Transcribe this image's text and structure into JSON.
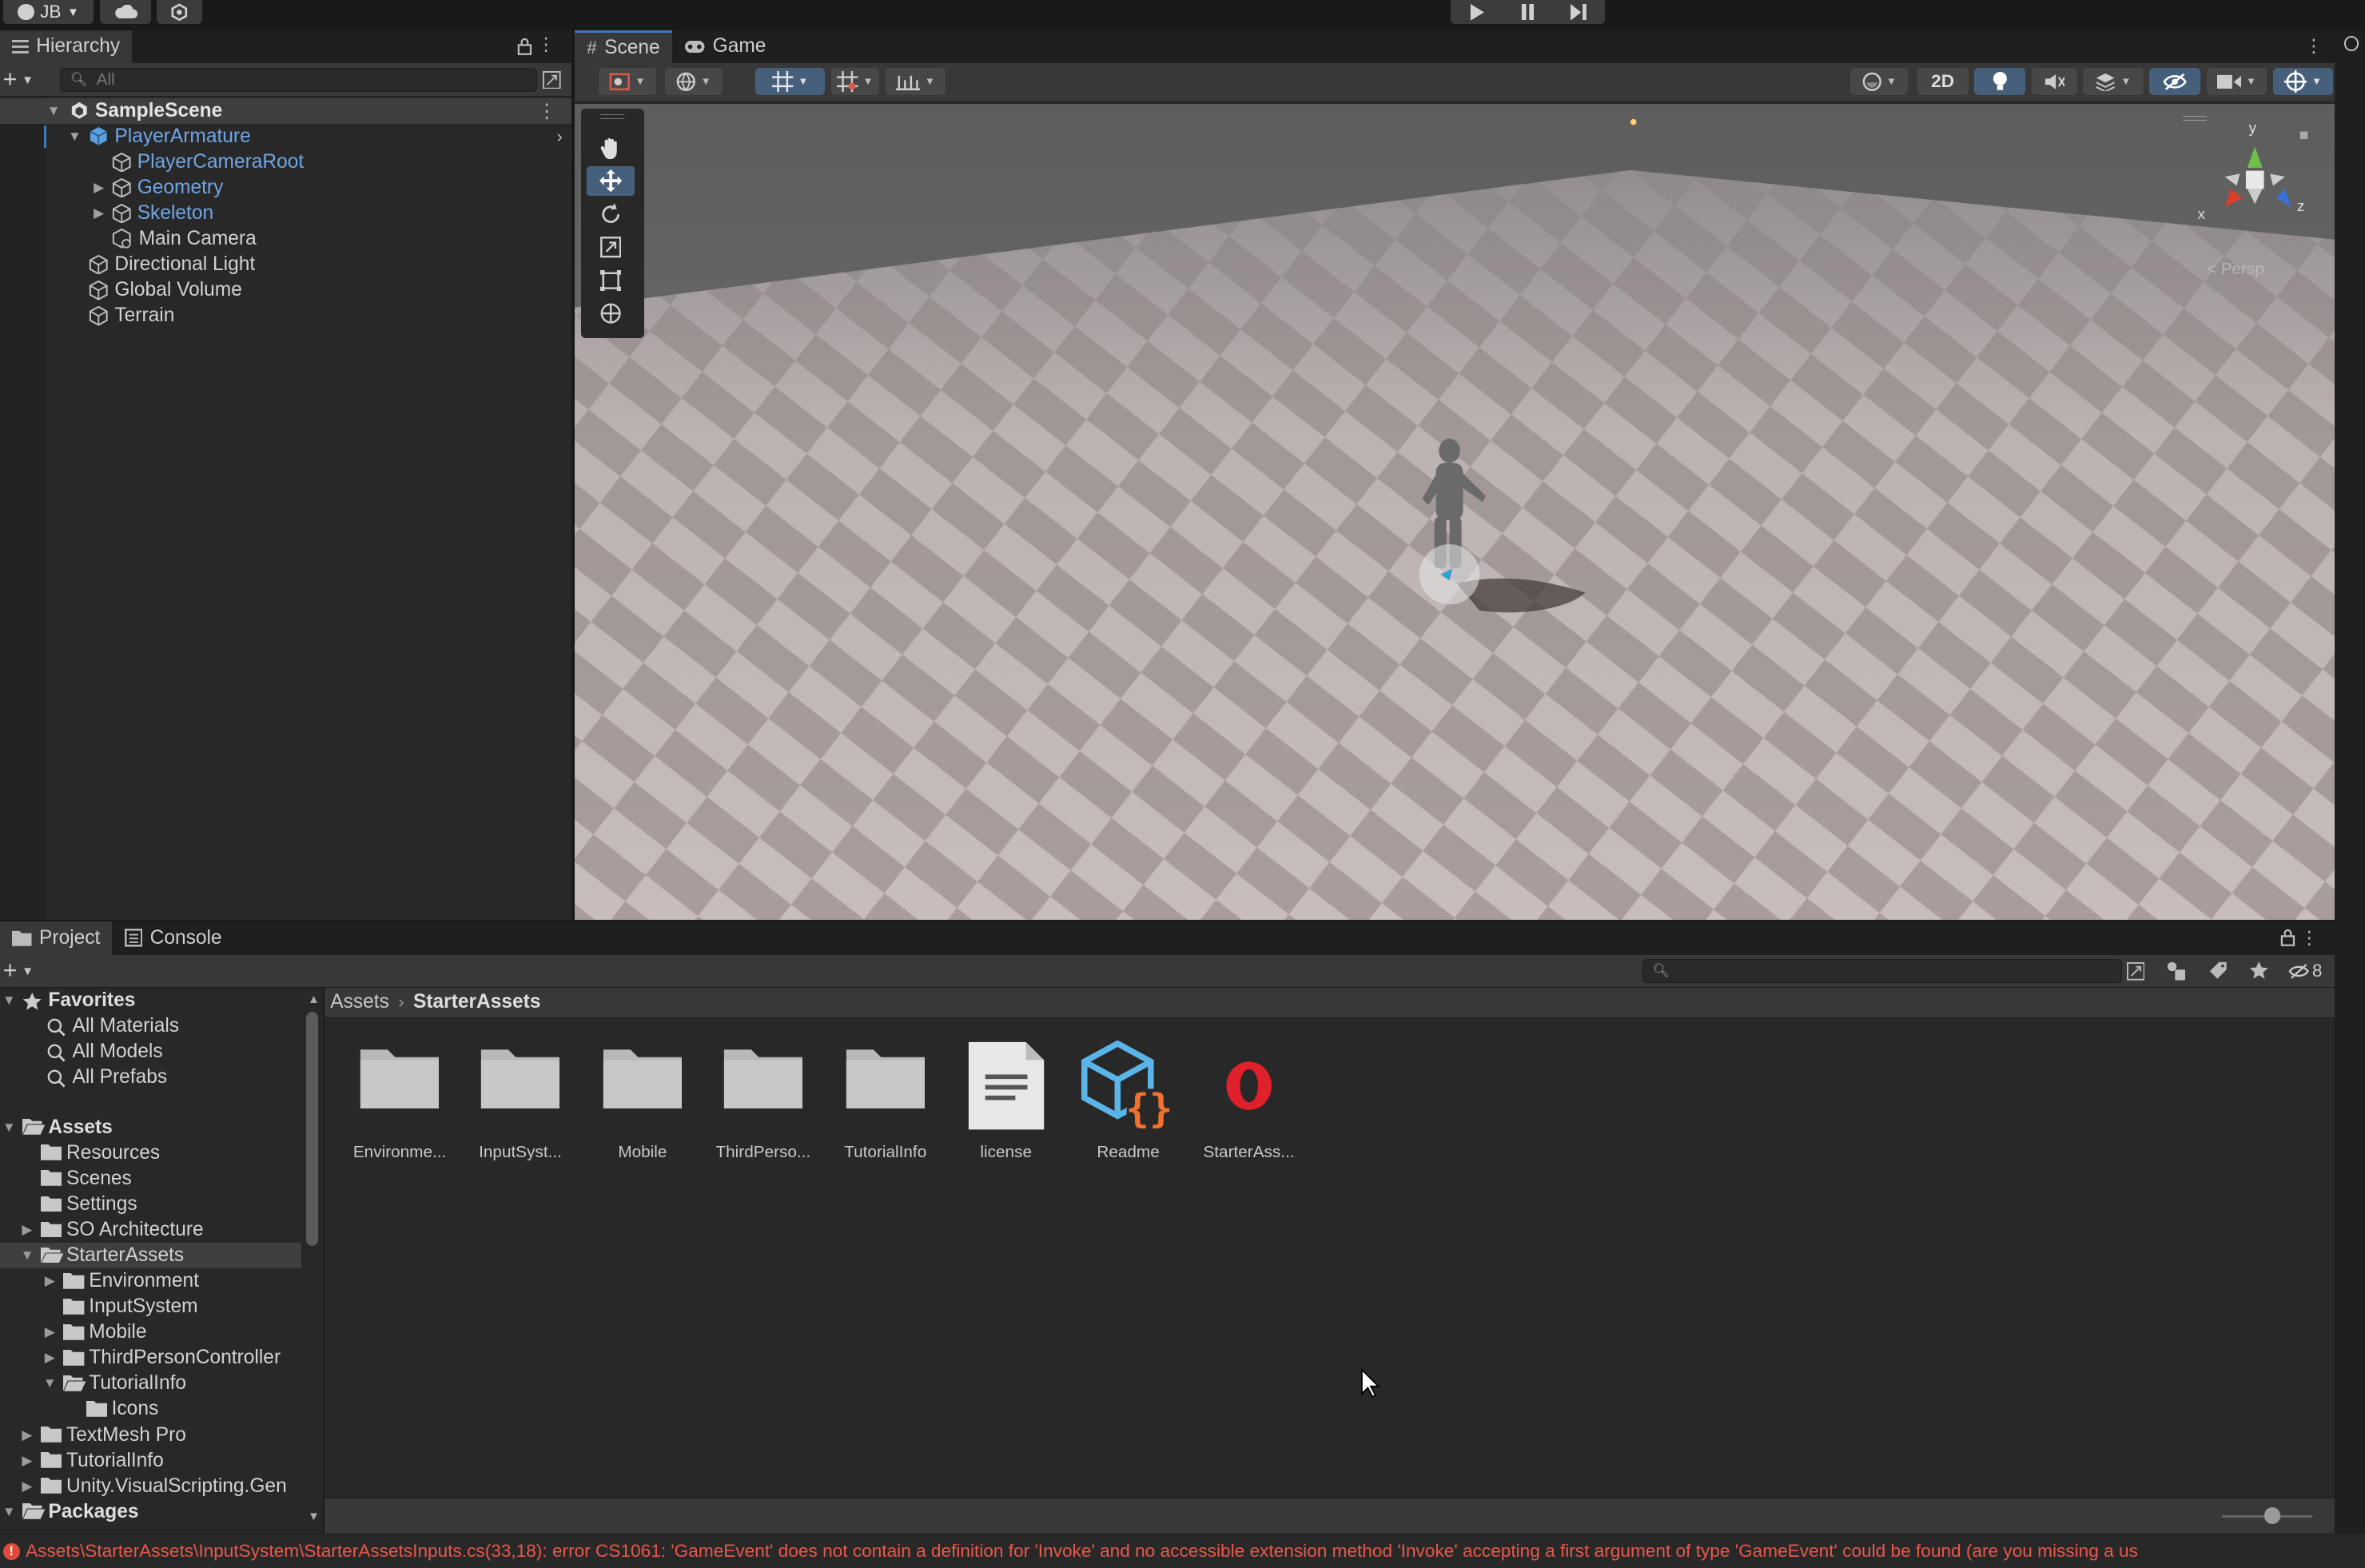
{
  "topbar": {
    "account_label": "JB"
  },
  "hierarchy": {
    "tab_label": "Hierarchy",
    "search_placeholder": "All",
    "items": [
      {
        "label": "SampleScene",
        "type": "scene"
      },
      {
        "label": "PlayerArmature",
        "type": "prefab"
      },
      {
        "label": "PlayerCameraRoot",
        "type": "prefab-child"
      },
      {
        "label": "Geometry",
        "type": "prefab-child"
      },
      {
        "label": "Skeleton",
        "type": "prefab-child"
      },
      {
        "label": "Main Camera",
        "type": "object"
      },
      {
        "label": "Directional Light",
        "type": "object"
      },
      {
        "label": "Global Volume",
        "type": "object"
      },
      {
        "label": "Terrain",
        "type": "object"
      }
    ]
  },
  "scene_view": {
    "tabs": [
      {
        "label": "Scene",
        "icon": "grid-icon",
        "active": true
      },
      {
        "label": "Game",
        "icon": "gamepad-icon",
        "active": false
      }
    ],
    "mode_2d_label": "2D",
    "projection_label": "< Persp",
    "axis_labels": {
      "x": "x",
      "y": "y",
      "z": "z"
    },
    "tools": [
      "hand-tool",
      "move-tool",
      "rotate-tool",
      "scale-tool",
      "rect-tool",
      "transform-tool"
    ],
    "active_tool": "move-tool"
  },
  "project": {
    "tabs": [
      {
        "label": "Project",
        "icon": "folder-icon",
        "active": true
      },
      {
        "label": "Console",
        "icon": "console-icon",
        "active": false
      }
    ],
    "hidden_count": "8",
    "breadcrumb": [
      "Assets",
      "StarterAssets"
    ],
    "tree": [
      {
        "label": "Favorites",
        "level": 0,
        "kind": "star",
        "bold": true,
        "arrow": "down"
      },
      {
        "label": "All Materials",
        "level": 1,
        "kind": "search"
      },
      {
        "label": "All Models",
        "level": 1,
        "kind": "search"
      },
      {
        "label": "All Prefabs",
        "level": 1,
        "kind": "search"
      },
      {
        "label": "Assets",
        "level": 0,
        "kind": "folder-open",
        "bold": true,
        "arrow": "down"
      },
      {
        "label": "Resources",
        "level": 1,
        "kind": "folder"
      },
      {
        "label": "Scenes",
        "level": 1,
        "kind": "folder"
      },
      {
        "label": "Settings",
        "level": 1,
        "kind": "folder"
      },
      {
        "label": "SO Architecture",
        "level": 1,
        "kind": "folder",
        "arrow": "right"
      },
      {
        "label": "StarterAssets",
        "level": 1,
        "kind": "folder-open",
        "arrow": "down",
        "selected": true
      },
      {
        "label": "Environment",
        "level": 2,
        "kind": "folder",
        "arrow": "right"
      },
      {
        "label": "InputSystem",
        "level": 2,
        "kind": "folder"
      },
      {
        "label": "Mobile",
        "level": 2,
        "kind": "folder",
        "arrow": "right"
      },
      {
        "label": "ThirdPersonController",
        "level": 2,
        "kind": "folder",
        "arrow": "right"
      },
      {
        "label": "TutorialInfo",
        "level": 2,
        "kind": "folder-open",
        "arrow": "down"
      },
      {
        "label": "Icons",
        "level": 3,
        "kind": "folder"
      },
      {
        "label": "TextMesh Pro",
        "level": 1,
        "kind": "folder",
        "arrow": "right"
      },
      {
        "label": "TutorialInfo",
        "level": 1,
        "kind": "folder",
        "arrow": "right"
      },
      {
        "label": "Unity.VisualScripting.Gen",
        "level": 1,
        "kind": "folder",
        "arrow": "right"
      },
      {
        "label": "Packages",
        "level": 0,
        "kind": "folder-open",
        "bold": true,
        "arrow": "down"
      }
    ],
    "assets": [
      {
        "label": "Environme...",
        "kind": "folder"
      },
      {
        "label": "InputSyst...",
        "kind": "folder"
      },
      {
        "label": "Mobile",
        "kind": "folder"
      },
      {
        "label": "ThirdPerso...",
        "kind": "folder"
      },
      {
        "label": "TutorialInfo",
        "kind": "folder"
      },
      {
        "label": "license",
        "kind": "text-file"
      },
      {
        "label": "Readme",
        "kind": "script-asset"
      },
      {
        "label": "StarterAss...",
        "kind": "opera-asset"
      }
    ]
  },
  "status_bar": {
    "error_text": "Assets\\StarterAssets\\InputSystem\\StarterAssetsInputs.cs(33,18): error CS1061: 'GameEvent' does not contain a definition for 'Invoke' and no accessible extension method 'Invoke' accepting a first argument of type 'GameEvent' could be found (are you missing a us"
  },
  "colors": {
    "accent_blue": "#3a79bb",
    "prefab_blue": "#6fa6e6",
    "error_red": "#e04a3a",
    "panel_bg": "#282828",
    "toolbar_bg": "#383838"
  }
}
